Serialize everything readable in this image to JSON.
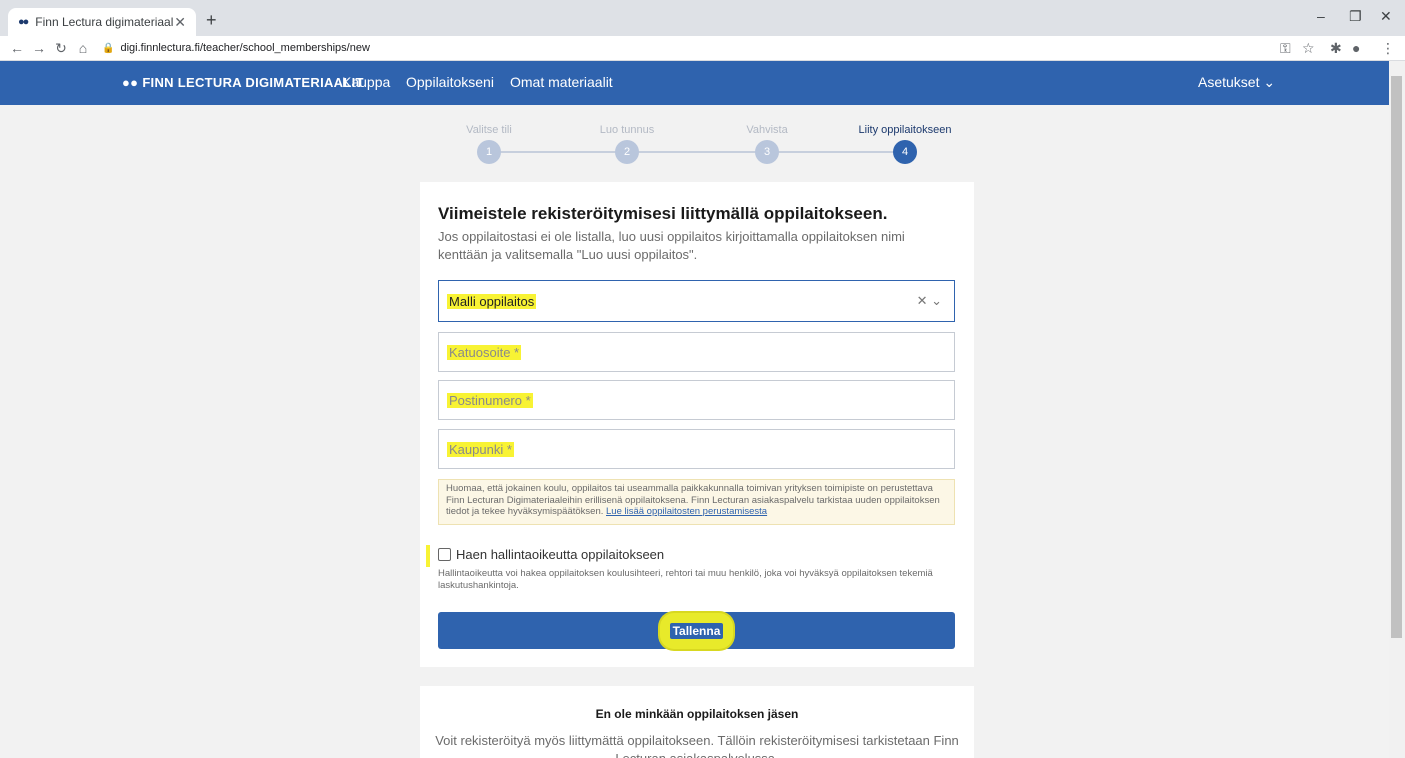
{
  "browser": {
    "tab_title": "Finn Lectura digimateriaalit",
    "url": "digi.finnlectura.fi/teacher/school_memberships/new"
  },
  "header": {
    "brand": "FINN LECTURA DIGIMATERIAALIT",
    "nav": [
      "Kauppa",
      "Oppilaitokseni",
      "Omat materiaalit"
    ],
    "settings": "Asetukset"
  },
  "stepper": {
    "steps": [
      {
        "label": "Valitse tili",
        "num": "1"
      },
      {
        "label": "Luo tunnus",
        "num": "2"
      },
      {
        "label": "Vahvista",
        "num": "3"
      },
      {
        "label": "Liity oppilaitokseen",
        "num": "4"
      }
    ],
    "active_index": 3
  },
  "form": {
    "title": "Viimeistele rekisteröitymisesi liittymällä oppilaitokseen.",
    "intro": "Jos oppilaitostasi ei ole listalla, luo uusi oppilaitos kirjoittamalla oppilaitoksen nimi kenttään ja valitsemalla \"Luo uusi oppilaitos\".",
    "school_value": "Malli oppilaitos",
    "street_placeholder": "Katuosoite *",
    "postal_placeholder": "Postinumero *",
    "city_placeholder": "Kaupunki *",
    "notice": "Huomaa, että jokainen koulu, oppilaitos tai useammalla paikkakunnalla toimivan yrityksen toimipiste on perustettava Finn Lecturan Digimateriaaleihin erillisenä oppilaitoksena. Finn Lecturan asiakaspalvelu tarkistaa uuden oppilaitoksen tiedot ja tekee hyväksymispäätöksen.",
    "notice_link": "Lue lisää oppilaitosten perustamisesta",
    "admin_checkbox_label": "Haen hallintaoikeutta oppilaitokseen",
    "admin_help": "Hallintaoikeutta voi hakea oppilaitoksen koulusihteeri, rehtori tai muu henkilö, joka voi hyväksyä oppilaitoksen tekemiä laskutushankintoja.",
    "save_label": "Tallenna"
  },
  "no_school": {
    "title": "En ole minkään oppilaitoksen jäsen",
    "text": "Voit rekisteröityä myös liittymättä oppilaitokseen. Tällöin rekisteröitymisesi tarkistetaan Finn Lecturan asiakaspalvelussa."
  },
  "colors": {
    "brand_blue": "#2f63ae",
    "highlight_yellow": "#f8f334"
  }
}
